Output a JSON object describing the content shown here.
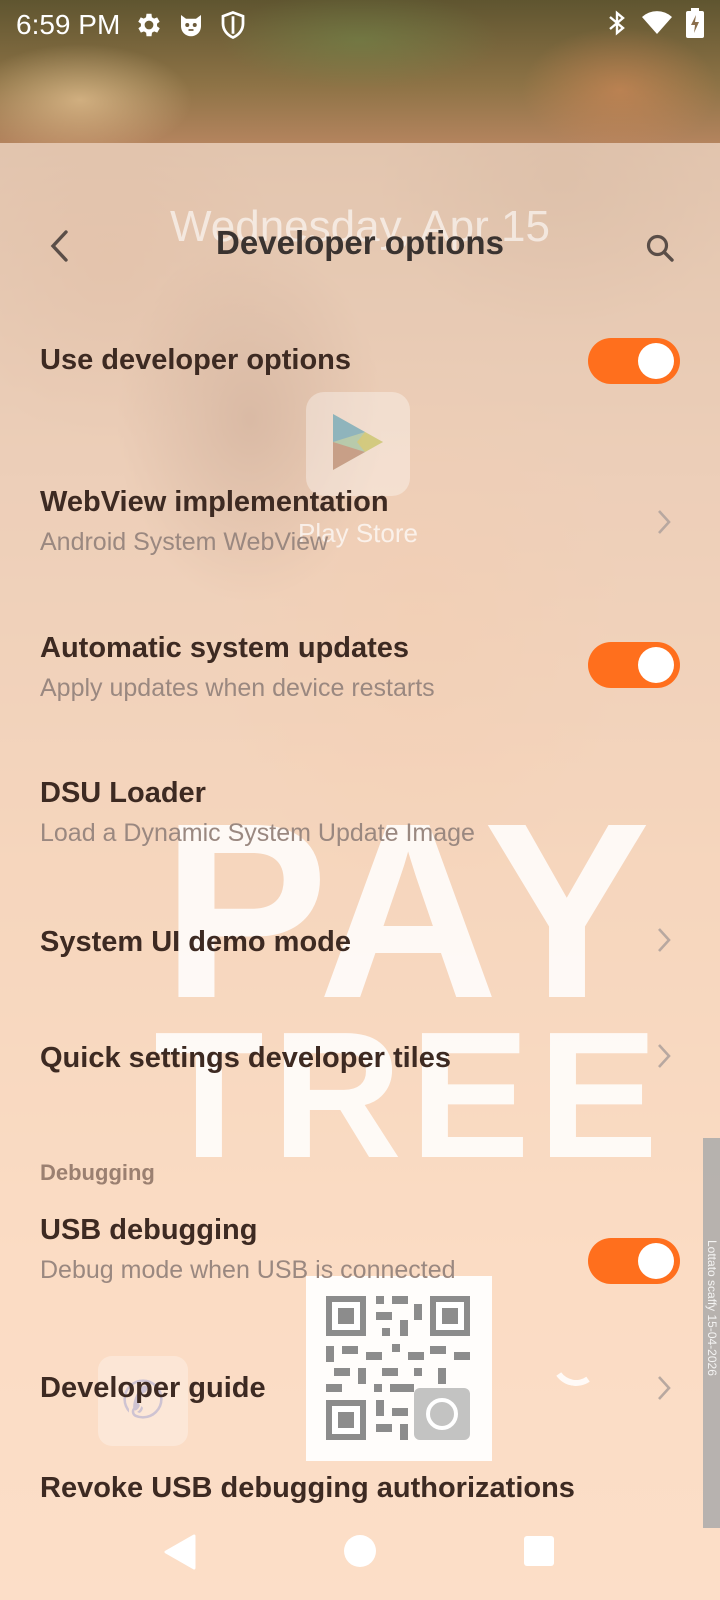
{
  "status_bar": {
    "time": "6:59 PM",
    "left_icons": [
      "gear-icon",
      "cat-face-icon",
      "shield-icon"
    ],
    "right_icons": [
      "bluetooth-icon",
      "wifi-icon",
      "battery-icon"
    ]
  },
  "background": {
    "date_text": "Wednesday, Apr 15",
    "watermark_line1": "PAY",
    "watermark_line2": "TREE",
    "app_icon_label": "Play Store",
    "side_tab_text": "Lottato scaffy 15-04-2026"
  },
  "app_bar": {
    "title": "Developer options",
    "back_icon": "back-arrow-icon",
    "search_icon": "search-icon"
  },
  "settings": [
    {
      "title": "Use developer options",
      "summary": "",
      "control": "toggle",
      "checked": true
    },
    {
      "title": "WebView implementation",
      "summary": "Android System WebView",
      "control": "chevron"
    },
    {
      "title": "Automatic system updates",
      "summary": "Apply updates when device restarts",
      "control": "toggle",
      "checked": true
    },
    {
      "title": "DSU Loader",
      "summary": "Load a Dynamic System Update Image",
      "control": "none"
    },
    {
      "title": "System UI demo mode",
      "summary": "",
      "control": "chevron"
    },
    {
      "title": "Quick settings developer tiles",
      "summary": "",
      "control": "chevron"
    }
  ],
  "debugging_section": {
    "header": "Debugging",
    "items": [
      {
        "title": "USB debugging",
        "summary": "Debug mode when USB is connected",
        "control": "toggle",
        "checked": true
      },
      {
        "title": "Developer guide",
        "summary": "",
        "control": "chevron"
      },
      {
        "title": "Revoke USB debugging authorizations",
        "summary": "",
        "control": "none"
      }
    ]
  },
  "colors": {
    "accent": "#ff6f1d",
    "title_text": "#3d2a22",
    "summary_text": "#9a8880",
    "section_header": "#9b8071"
  },
  "nav_bar": {
    "buttons": [
      "nav-back-icon",
      "nav-home-icon",
      "nav-recents-icon"
    ]
  }
}
